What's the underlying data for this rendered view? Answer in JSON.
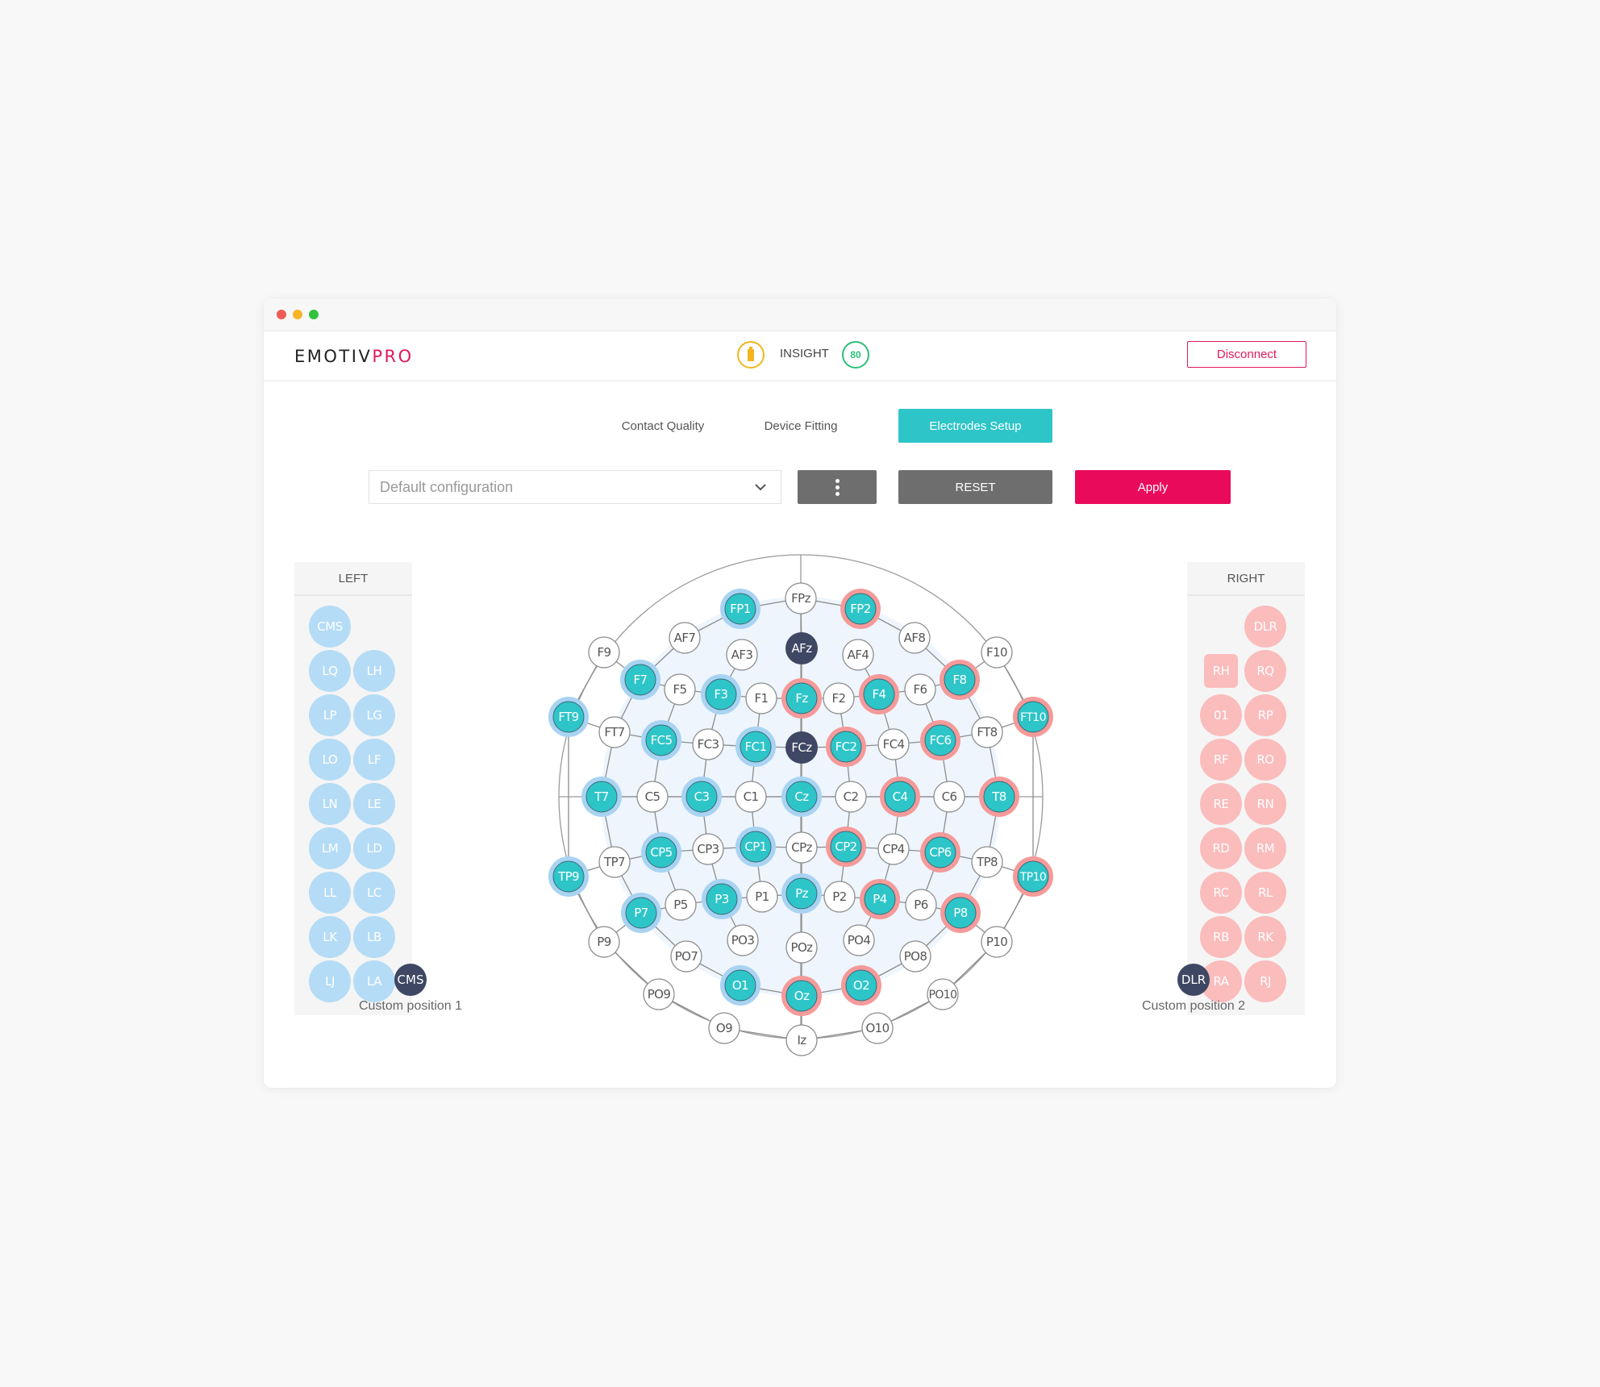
{
  "window": {
    "controls": [
      "close",
      "minimize",
      "maximize"
    ]
  },
  "header": {
    "logo_main": "EMOTIV",
    "logo_accent": "PRO",
    "battery_icon": "battery-icon",
    "device_name": "INSIGHT",
    "signal_value": "80",
    "disconnect_label": "Disconnect"
  },
  "tabs": [
    {
      "label": "Contact Quality",
      "active": false
    },
    {
      "label": "Device Fitting",
      "active": false
    },
    {
      "label": "Electrodes Setup",
      "active": true
    }
  ],
  "toolbar": {
    "config_select_value": "Default configuration",
    "more_icon": "kebab-vertical-icon",
    "reset_label": "RESET",
    "apply_label": "Apply"
  },
  "left_panel": {
    "title": "LEFT",
    "chips": [
      [
        "CMS",
        null
      ],
      [
        "LQ",
        "LH"
      ],
      [
        "LP",
        "LG"
      ],
      [
        "LO",
        "LF"
      ],
      [
        "LN",
        "LE"
      ],
      [
        "LM",
        "LD"
      ],
      [
        "LL",
        "LC"
      ],
      [
        "LK",
        "LB"
      ],
      [
        "LJ",
        "LA"
      ]
    ]
  },
  "right_panel": {
    "title": "RIGHT",
    "chips": [
      [
        null,
        "DLR"
      ],
      [
        "RH",
        "RQ"
      ],
      [
        "01",
        "RP"
      ],
      [
        "RF",
        "RO"
      ],
      [
        "RE",
        "RN"
      ],
      [
        "RD",
        "RM"
      ],
      [
        "RC",
        "RL"
      ],
      [
        "RB",
        "RK"
      ],
      [
        "RA",
        "RJ"
      ]
    ]
  },
  "custom_positions": [
    {
      "badge": "CMS",
      "label": "Custom position 1"
    },
    {
      "badge": "DLR",
      "label": "Custom position 2"
    }
  ],
  "colors": {
    "active_fill": "#2ec5c8",
    "left_ring": "#a9d3f2",
    "right_ring": "#f59a9a",
    "reference_fill": "#3e4763",
    "accent_pink": "#ea0a5b",
    "left_chip": "#b5dcf6",
    "right_chip": "#fbbcbc"
  },
  "electrodes": [
    {
      "id": "FPz",
      "state": "empty"
    },
    {
      "id": "FP1",
      "state": "left"
    },
    {
      "id": "FP2",
      "state": "right"
    },
    {
      "id": "AF7",
      "state": "empty"
    },
    {
      "id": "AF3",
      "state": "empty"
    },
    {
      "id": "AFz",
      "state": "reference"
    },
    {
      "id": "AF4",
      "state": "empty"
    },
    {
      "id": "AF8",
      "state": "empty"
    },
    {
      "id": "F9",
      "state": "empty"
    },
    {
      "id": "F7",
      "state": "left"
    },
    {
      "id": "F5",
      "state": "empty"
    },
    {
      "id": "F3",
      "state": "left"
    },
    {
      "id": "F1",
      "state": "empty"
    },
    {
      "id": "Fz",
      "state": "right"
    },
    {
      "id": "F2",
      "state": "empty"
    },
    {
      "id": "F4",
      "state": "right"
    },
    {
      "id": "F6",
      "state": "empty"
    },
    {
      "id": "F8",
      "state": "right"
    },
    {
      "id": "F10",
      "state": "empty"
    },
    {
      "id": "FT9",
      "state": "left"
    },
    {
      "id": "FT7",
      "state": "empty"
    },
    {
      "id": "FC5",
      "state": "left"
    },
    {
      "id": "FC3",
      "state": "empty"
    },
    {
      "id": "FC1",
      "state": "left"
    },
    {
      "id": "FCz",
      "state": "reference"
    },
    {
      "id": "FC2",
      "state": "right"
    },
    {
      "id": "FC4",
      "state": "empty"
    },
    {
      "id": "FC6",
      "state": "right"
    },
    {
      "id": "FT8",
      "state": "empty"
    },
    {
      "id": "FT10",
      "state": "right"
    },
    {
      "id": "T7",
      "state": "left"
    },
    {
      "id": "C5",
      "state": "empty"
    },
    {
      "id": "C3",
      "state": "left"
    },
    {
      "id": "C1",
      "state": "empty"
    },
    {
      "id": "Cz",
      "state": "left"
    },
    {
      "id": "C2",
      "state": "empty"
    },
    {
      "id": "C4",
      "state": "right"
    },
    {
      "id": "C6",
      "state": "empty"
    },
    {
      "id": "T8",
      "state": "right"
    },
    {
      "id": "TP9",
      "state": "left"
    },
    {
      "id": "TP7",
      "state": "empty"
    },
    {
      "id": "CP5",
      "state": "left"
    },
    {
      "id": "CP3",
      "state": "empty"
    },
    {
      "id": "CP1",
      "state": "left"
    },
    {
      "id": "CPz",
      "state": "empty"
    },
    {
      "id": "CP2",
      "state": "right"
    },
    {
      "id": "CP4",
      "state": "empty"
    },
    {
      "id": "CP6",
      "state": "right"
    },
    {
      "id": "TP8",
      "state": "empty"
    },
    {
      "id": "TP10",
      "state": "right"
    },
    {
      "id": "P9",
      "state": "empty"
    },
    {
      "id": "P7",
      "state": "left"
    },
    {
      "id": "P5",
      "state": "empty"
    },
    {
      "id": "P3",
      "state": "left"
    },
    {
      "id": "P1",
      "state": "empty"
    },
    {
      "id": "Pz",
      "state": "left"
    },
    {
      "id": "P2",
      "state": "empty"
    },
    {
      "id": "P4",
      "state": "right"
    },
    {
      "id": "P6",
      "state": "empty"
    },
    {
      "id": "P8",
      "state": "right"
    },
    {
      "id": "P10",
      "state": "empty"
    },
    {
      "id": "PO9",
      "state": "empty"
    },
    {
      "id": "PO7",
      "state": "empty"
    },
    {
      "id": "PO3",
      "state": "empty"
    },
    {
      "id": "POz",
      "state": "empty"
    },
    {
      "id": "PO4",
      "state": "empty"
    },
    {
      "id": "PO8",
      "state": "empty"
    },
    {
      "id": "PO10",
      "state": "empty"
    },
    {
      "id": "O1",
      "state": "left"
    },
    {
      "id": "Oz",
      "state": "right"
    },
    {
      "id": "O2",
      "state": "right"
    },
    {
      "id": "O9",
      "state": "empty"
    },
    {
      "id": "Iz",
      "state": "empty"
    },
    {
      "id": "O10",
      "state": "empty"
    }
  ]
}
